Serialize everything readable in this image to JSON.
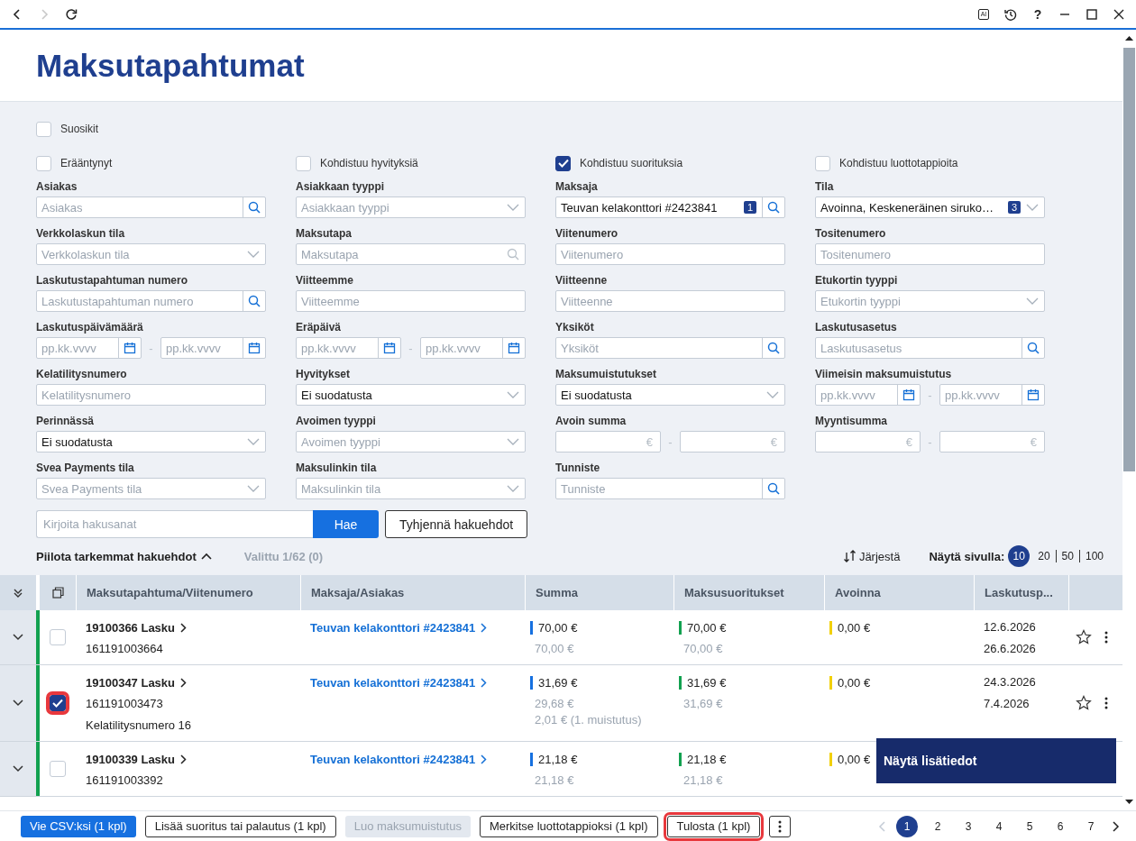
{
  "toolbar": {
    "ai_label": "AI",
    "help": "?"
  },
  "title": "Maksutapahtumat",
  "filters": {
    "favorites": {
      "label": "Suosikit",
      "checked": false
    },
    "flags": [
      {
        "label": "Erääntynyt",
        "checked": false
      },
      {
        "label": "Kohdistuu hyvityksiä",
        "checked": false
      },
      {
        "label": "Kohdistuu suorituksia",
        "checked": true
      },
      {
        "label": "Kohdistuu luottotappioita",
        "checked": false
      }
    ],
    "fields": [
      {
        "kind": "search",
        "label": "Asiakas",
        "placeholder": "Asiakas"
      },
      {
        "kind": "select",
        "label": "Asiakkaan tyyppi",
        "placeholder": "Asiakkaan tyyppi"
      },
      {
        "kind": "search",
        "label": "Maksaja",
        "value": "Teuvan kelakonttori  #2423841",
        "badge": "1"
      },
      {
        "kind": "select",
        "label": "Tila",
        "value": "Avoinna, Keskeneräinen siruko…",
        "badge": "3"
      },
      {
        "kind": "select",
        "label": "Verkkolaskun tila",
        "placeholder": "Verkkolaskun tila"
      },
      {
        "kind": "lookup",
        "label": "Maksutapa",
        "placeholder": "Maksutapa"
      },
      {
        "kind": "text",
        "label": "Viitenumero",
        "placeholder": "Viitenumero"
      },
      {
        "kind": "text",
        "label": "Tositenumero",
        "placeholder": "Tositenumero"
      },
      {
        "kind": "search",
        "label": "Laskutustapahtuman numero",
        "placeholder": "Laskutustapahtuman numero"
      },
      {
        "kind": "text",
        "label": "Viitteemme",
        "placeholder": "Viitteemme"
      },
      {
        "kind": "text",
        "label": "Viitteenne",
        "placeholder": "Viitteenne"
      },
      {
        "kind": "select",
        "label": "Etukortin tyyppi",
        "placeholder": "Etukortin tyyppi"
      },
      {
        "kind": "date_range",
        "label": "Laskutuspäivämäärä",
        "from": {
          "placeholder": "pp.kk.vvvv"
        },
        "separator": "-",
        "to": {
          "placeholder": "pp.kk.vvvv"
        }
      },
      {
        "kind": "date_range",
        "label": "Eräpäivä",
        "from": {
          "placeholder": "pp.kk.vvvv"
        },
        "separator": "-",
        "to": {
          "placeholder": "pp.kk.vvvv"
        }
      },
      {
        "kind": "search",
        "label": "Yksiköt",
        "placeholder": "Yksiköt"
      },
      {
        "kind": "search",
        "label": "Laskutusasetus",
        "placeholder": "Laskutusasetus"
      },
      {
        "kind": "text",
        "label": "Kelatilitysnumero",
        "placeholder": "Kelatilitysnumero"
      },
      {
        "kind": "select",
        "label": "Hyvitykset",
        "value": "Ei suodatusta"
      },
      {
        "kind": "select",
        "label": "Maksumuistutukset",
        "value": "Ei suodatusta"
      },
      {
        "kind": "date_range",
        "label": "Viimeisin maksumuistutus",
        "from": {
          "placeholder": "pp.kk.vvvv"
        },
        "separator": "-",
        "to": {
          "placeholder": "pp.kk.vvvv"
        }
      },
      {
        "kind": "select",
        "label": "Perinnässä",
        "value": "Ei suodatusta"
      },
      {
        "kind": "select",
        "label": "Avoimen tyyppi",
        "placeholder": "Avoimen tyyppi"
      },
      {
        "kind": "money_range",
        "label": "Avoin summa",
        "from": {
          "unit": "€"
        },
        "separator": "-",
        "to": {
          "unit": "€"
        }
      },
      {
        "kind": "money_range",
        "label": "Myyntisumma",
        "from": {
          "unit": "€"
        },
        "separator": "-",
        "to": {
          "unit": "€"
        }
      },
      {
        "kind": "select",
        "label": "Svea Payments tila",
        "placeholder": "Svea Payments tila"
      },
      {
        "kind": "select",
        "label": "Maksulinkin tila",
        "placeholder": "Maksulinkin tila"
      },
      {
        "kind": "search",
        "label": "Tunniste",
        "placeholder": "Tunniste"
      }
    ]
  },
  "search": {
    "placeholder": "Kirjoita hakusanat",
    "button": "Hae",
    "clear": "Tyhjennä hakuehdot"
  },
  "toggle_filters": "Piilota tarkemmat hakuehdot",
  "selection": "Valittu 1/62 (0)",
  "sort": "Järjestä",
  "page_size": {
    "label": "Näytä sivulla:",
    "options": [
      {
        "label": "10",
        "selected": true
      },
      {
        "label": "20",
        "selected": false
      },
      {
        "label": "50",
        "selected": false
      },
      {
        "label": "100",
        "selected": false
      }
    ]
  },
  "table": {
    "columns": [
      "Maksutapahtuma/Viitenumero",
      "Maksaja/Asiakas",
      "Summa",
      "Maksusuoritukset",
      "Avoinna",
      "Laskutusp..."
    ],
    "rows": [
      {
        "color": "#12a150",
        "checked": false,
        "highlighted": false,
        "title": "19100366 Lasku",
        "reference": "161191003664",
        "payer": "Teuvan kelakonttori #2423841",
        "sum": "70,00 €",
        "sum_details": [
          "70,00 €"
        ],
        "payments": "70,00 €",
        "payment_details": [
          "70,00 €"
        ],
        "open": "0,00 €",
        "dates": [
          "12.6.2026",
          "26.6.2026"
        ],
        "favorite": false
      },
      {
        "color": "#12a150",
        "checked": true,
        "highlighted": true,
        "title": "19100347 Lasku",
        "reference": "161191003473",
        "extra": "Kelatilitysnumero 16",
        "payer": "Teuvan kelakonttori #2423841",
        "sum": "31,69 €",
        "sum_details": [
          "29,68 €",
          "2,01 € (1. muistutus)"
        ],
        "payments": "31,69 €",
        "payment_details": [
          "31,69 €"
        ],
        "open": "0,00 €",
        "dates": [
          "24.3.2026",
          "7.4.2026"
        ],
        "favorite": false
      },
      {
        "color": "#12a150",
        "checked": false,
        "highlighted": false,
        "title": "19100339 Lasku",
        "reference": "161191003392",
        "payer": "Teuvan kelakonttori #2423841",
        "sum": "21,18 €",
        "sum_details": [
          "21,18 €"
        ],
        "payments": "21,18 €",
        "payment_details": [
          "21,18 €"
        ],
        "open": "0,00 €",
        "dates": []
      }
    ]
  },
  "tooltip": "Näytä lisätiedot",
  "actions": [
    {
      "kind": "primary",
      "label": "Vie CSV:ksi (1 kpl)",
      "highlighted": false
    },
    {
      "kind": "outline",
      "label": "Lisää suoritus tai palautus (1 kpl)",
      "highlighted": false
    },
    {
      "kind": "disabled",
      "label": "Luo maksumuistutus",
      "highlighted": false
    },
    {
      "kind": "outline",
      "label": "Merkitse luottotappioksi (1 kpl)",
      "highlighted": false
    },
    {
      "kind": "outline",
      "label": "Tulosta (1 kpl)",
      "highlighted": true
    }
  ],
  "pagination": [
    {
      "label": "1",
      "selected": true
    },
    {
      "label": "2",
      "selected": false
    },
    {
      "label": "3",
      "selected": false
    },
    {
      "label": "4",
      "selected": false
    },
    {
      "label": "5",
      "selected": false
    },
    {
      "label": "6",
      "selected": false
    },
    {
      "label": "7",
      "selected": false
    }
  ]
}
